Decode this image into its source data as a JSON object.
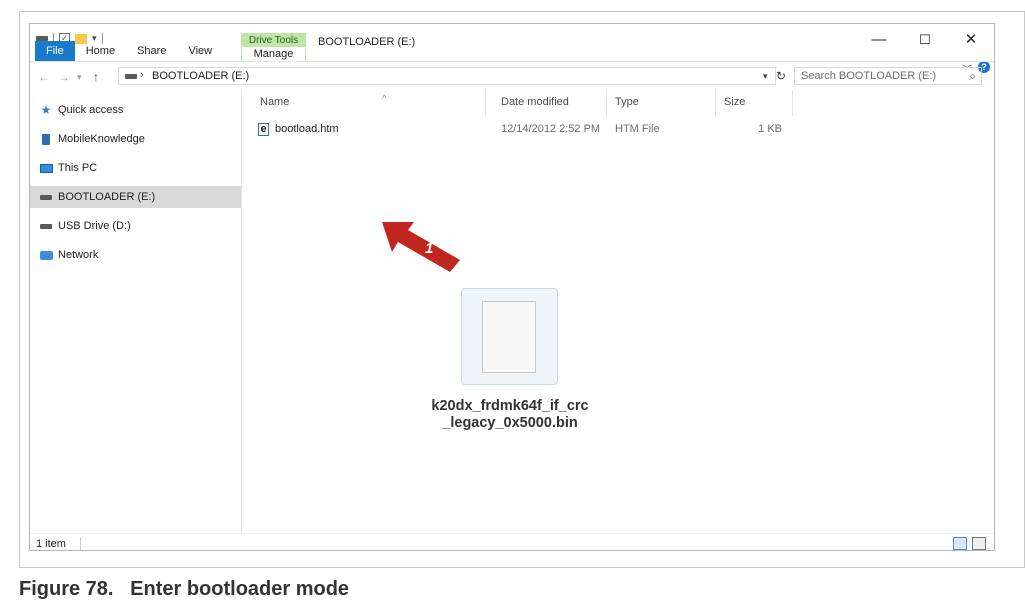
{
  "window": {
    "title": "BOOTLOADER (E:)",
    "context_group": "Drive Tools",
    "context_tab": "Manage",
    "controls": {
      "minimize": "—",
      "maximize": "☐",
      "close": "✕"
    }
  },
  "ribbon": {
    "tabs": [
      "File",
      "Home",
      "Share",
      "View"
    ]
  },
  "address_bar": {
    "path": "BOOTLOADER (E:)",
    "search_placeholder": "Search BOOTLOADER (E:)"
  },
  "nav_pane": {
    "items": [
      {
        "label": "Quick access",
        "icon": "star-icon"
      },
      {
        "label": "MobileKnowledge",
        "icon": "phone-icon"
      },
      {
        "label": "This PC",
        "icon": "monitor-icon"
      },
      {
        "label": "BOOTLOADER (E:)",
        "icon": "drive-icon",
        "selected": true
      },
      {
        "label": "USB Drive (D:)",
        "icon": "drive-icon"
      },
      {
        "label": "Network",
        "icon": "network-icon"
      }
    ]
  },
  "file_list": {
    "columns": [
      "Name",
      "Date modified",
      "Type",
      "Size"
    ],
    "rows": [
      {
        "name": "bootload.htm",
        "date": "12/14/2012 2:52 PM",
        "type": "HTM File",
        "size": "1 KB"
      }
    ]
  },
  "status_bar": {
    "count": "1 item"
  },
  "overlay": {
    "step_number": "1",
    "dragged_file_name_line1": "k20dx_frdmk64f_if_crc",
    "dragged_file_name_line2": "_legacy_0x5000.bin",
    "arrow_color": "#c0271e"
  },
  "caption": "Figure 78.   Enter bootloader mode"
}
